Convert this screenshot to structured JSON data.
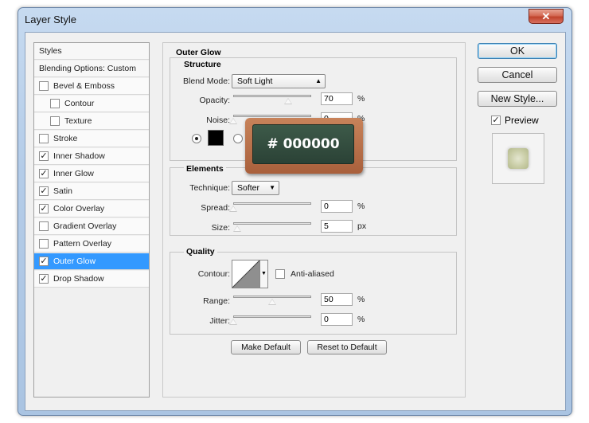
{
  "window": {
    "title": "Layer Style",
    "close_glyph": "✕"
  },
  "style_list": [
    {
      "label": "Styles",
      "checkbox": false,
      "header": true
    },
    {
      "label": "Blending Options: Custom",
      "checkbox": false,
      "header": true
    },
    {
      "label": "Bevel & Emboss",
      "checkbox": true,
      "checked": false
    },
    {
      "label": "Contour",
      "checkbox": true,
      "checked": false,
      "indent": true
    },
    {
      "label": "Texture",
      "checkbox": true,
      "checked": false,
      "indent": true
    },
    {
      "label": "Stroke",
      "checkbox": true,
      "checked": false
    },
    {
      "label": "Inner Shadow",
      "checkbox": true,
      "checked": true
    },
    {
      "label": "Inner Glow",
      "checkbox": true,
      "checked": true
    },
    {
      "label": "Satin",
      "checkbox": true,
      "checked": true
    },
    {
      "label": "Color Overlay",
      "checkbox": true,
      "checked": true
    },
    {
      "label": "Gradient Overlay",
      "checkbox": true,
      "checked": false
    },
    {
      "label": "Pattern Overlay",
      "checkbox": true,
      "checked": false
    },
    {
      "label": "Outer Glow",
      "checkbox": true,
      "checked": true,
      "selected": true
    },
    {
      "label": "Drop Shadow",
      "checkbox": true,
      "checked": true
    }
  ],
  "outer_glow": {
    "title": "Outer Glow",
    "structure": {
      "title": "Structure",
      "blend_mode_label": "Blend Mode:",
      "blend_mode_value": "Soft Light",
      "opacity_label": "Opacity:",
      "opacity_value": "70",
      "opacity_unit": "%",
      "opacity_level": 0.7,
      "noise_label": "Noise:",
      "noise_value": "0",
      "noise_unit": "%",
      "noise_level": 0.0
    },
    "elements": {
      "title": "Elements",
      "technique_label": "Technique:",
      "technique_value": "Softer",
      "spread_label": "Spread:",
      "spread_value": "0",
      "spread_unit": "%",
      "size_label": "Size:",
      "size_value": "5",
      "size_unit": "px"
    },
    "quality": {
      "title": "Quality",
      "contour_label": "Contour:",
      "antialiased_label": "Anti-aliased",
      "range_label": "Range:",
      "range_value": "50",
      "range_unit": "%",
      "range_level": 0.5,
      "jitter_label": "Jitter:",
      "jitter_value": "0",
      "jitter_unit": "%",
      "jitter_level": 0.0
    },
    "make_default_label": "Make Default",
    "reset_default_label": "Reset to Default"
  },
  "buttons": {
    "ok": "OK",
    "cancel": "Cancel",
    "new_style": "New Style...",
    "preview_label": "Preview",
    "check_glyph": "✓"
  },
  "tooltip": {
    "text": "# 000000"
  },
  "colors": {
    "selection": "#3399ff",
    "glow_color": "#000000",
    "tooltip_board": "#2f4a3c",
    "tooltip_frame": "#b06a44"
  }
}
